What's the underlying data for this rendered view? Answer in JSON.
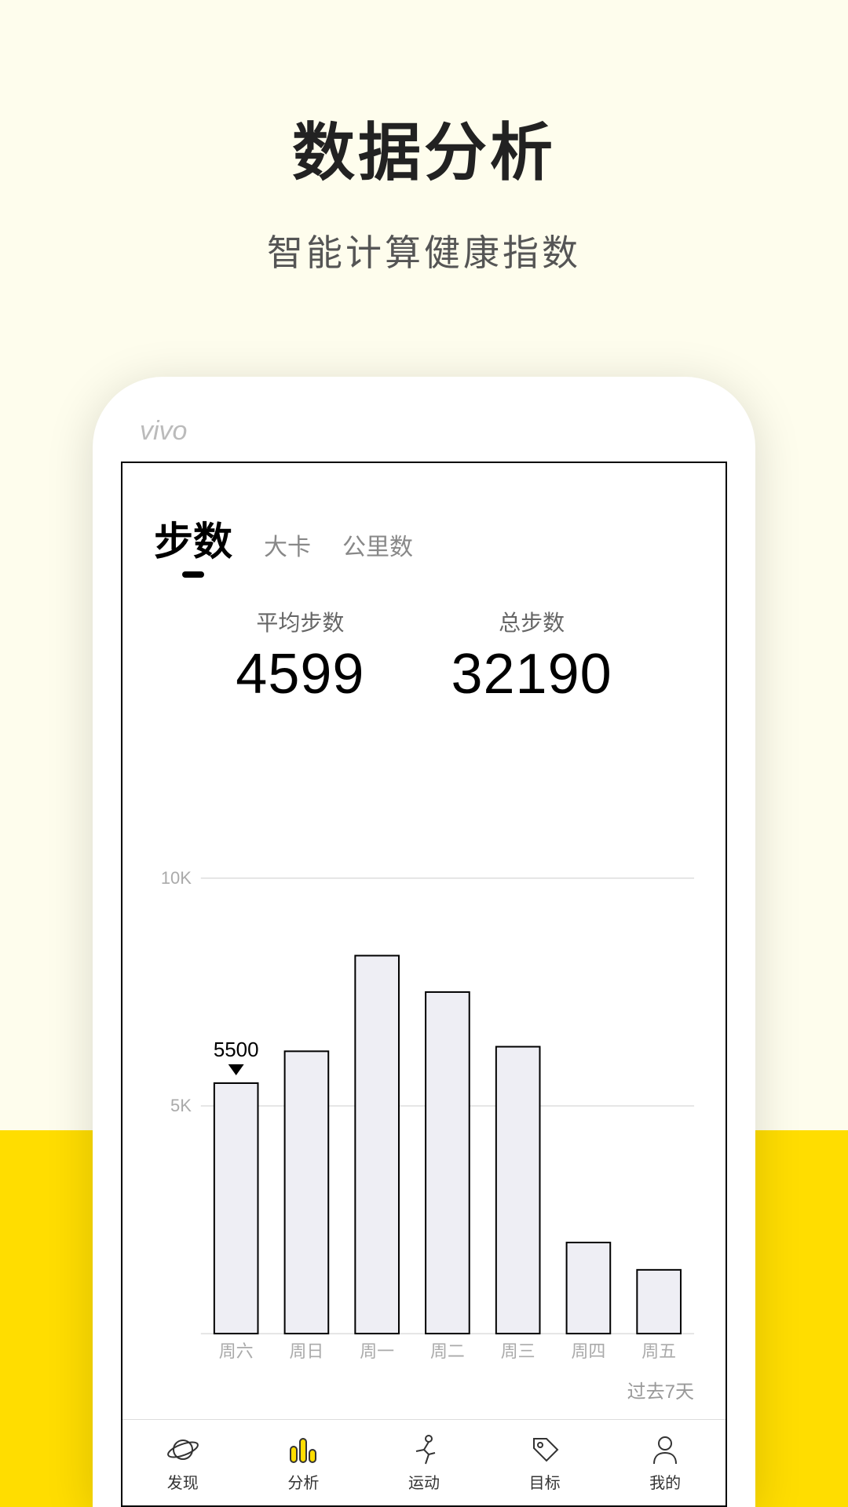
{
  "header": {
    "title": "数据分析",
    "subtitle": "智能计算健康指数"
  },
  "phone": {
    "brand": "vivo"
  },
  "tabs": [
    {
      "label": "步数",
      "active": true
    },
    {
      "label": "大卡",
      "active": false
    },
    {
      "label": "公里数",
      "active": false
    }
  ],
  "stats": {
    "avg": {
      "label": "平均步数",
      "value": "4599"
    },
    "total": {
      "label": "总步数",
      "value": "32190"
    }
  },
  "chart_data": {
    "type": "bar",
    "categories": [
      "周六",
      "周日",
      "周一",
      "周二",
      "周三",
      "周四",
      "周五"
    ],
    "values": [
      5500,
      6200,
      8300,
      7500,
      6300,
      2000,
      1400
    ],
    "callout": {
      "index": 0,
      "text": "5500"
    },
    "yticks": [
      {
        "label": "5K",
        "value": 5000
      },
      {
        "label": "10K",
        "value": 10000
      }
    ],
    "ylim": [
      0,
      11000
    ],
    "title": "",
    "xlabel": "",
    "ylabel": ""
  },
  "footer_note": "过去7天",
  "nav": [
    {
      "icon": "planet-icon",
      "label": "发现"
    },
    {
      "icon": "chart-icon",
      "label": "分析",
      "active": true
    },
    {
      "icon": "runner-icon",
      "label": "运动"
    },
    {
      "icon": "tag-icon",
      "label": "目标"
    },
    {
      "icon": "person-icon",
      "label": "我的"
    }
  ]
}
